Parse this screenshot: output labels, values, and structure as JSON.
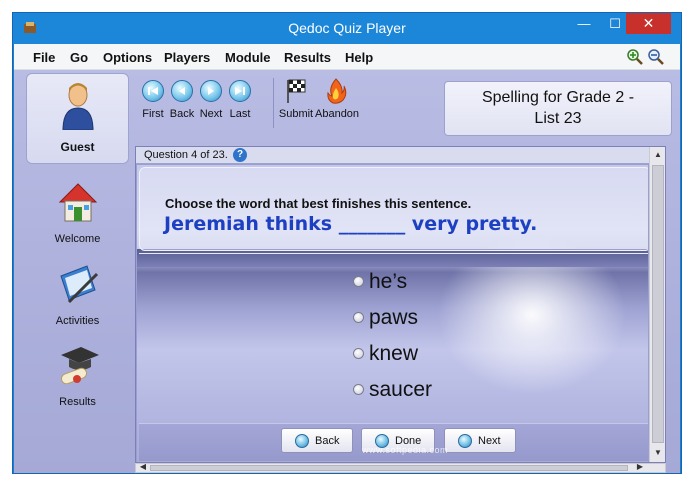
{
  "window": {
    "title": "Qedoc Quiz Player",
    "minimize": "—",
    "maximize": "☐",
    "close": "✕"
  },
  "menu": {
    "items": [
      "File",
      "Go",
      "Options",
      "Players",
      "Module",
      "Results",
      "Help"
    ],
    "zoom_in_icon": "zoom-in-icon",
    "zoom_out_icon": "zoom-out-icon"
  },
  "sidebar": {
    "user": "Guest",
    "items": [
      {
        "label": "Welcome",
        "icon": "house-icon"
      },
      {
        "label": "Activities",
        "icon": "book-pen-icon"
      },
      {
        "label": "Results",
        "icon": "graduation-cap-icon"
      }
    ]
  },
  "toolbar": {
    "buttons": [
      {
        "label": "First",
        "icon": "first-icon"
      },
      {
        "label": "Back",
        "icon": "back-icon"
      },
      {
        "label": "Next",
        "icon": "next-icon"
      },
      {
        "label": "Last",
        "icon": "last-icon"
      },
      {
        "label": "Submit",
        "icon": "checkered-flag-icon"
      },
      {
        "label": "Abandon",
        "icon": "fire-icon"
      }
    ]
  },
  "course": {
    "line1": "Spelling for Grade 2 -",
    "line2": "List 23"
  },
  "question": {
    "header": "Question 4 of 23.",
    "help_icon": "?",
    "instruction": "Choose the word that best finishes this sentence.",
    "sentence": "Jeremiah thinks _______ very pretty.",
    "options": [
      "he’s",
      "paws",
      "knew",
      "saucer"
    ]
  },
  "nav_buttons": {
    "back": "Back",
    "done": "Done",
    "next": "Next"
  },
  "scrollbars": {
    "up": "▲",
    "down": "▼",
    "left": "◀",
    "right": "▶"
  },
  "watermark": "www.softpedia.com",
  "colors": {
    "titlebar": "#1c86d8",
    "sentence": "#1d3fc2",
    "close": "#c7302b"
  }
}
